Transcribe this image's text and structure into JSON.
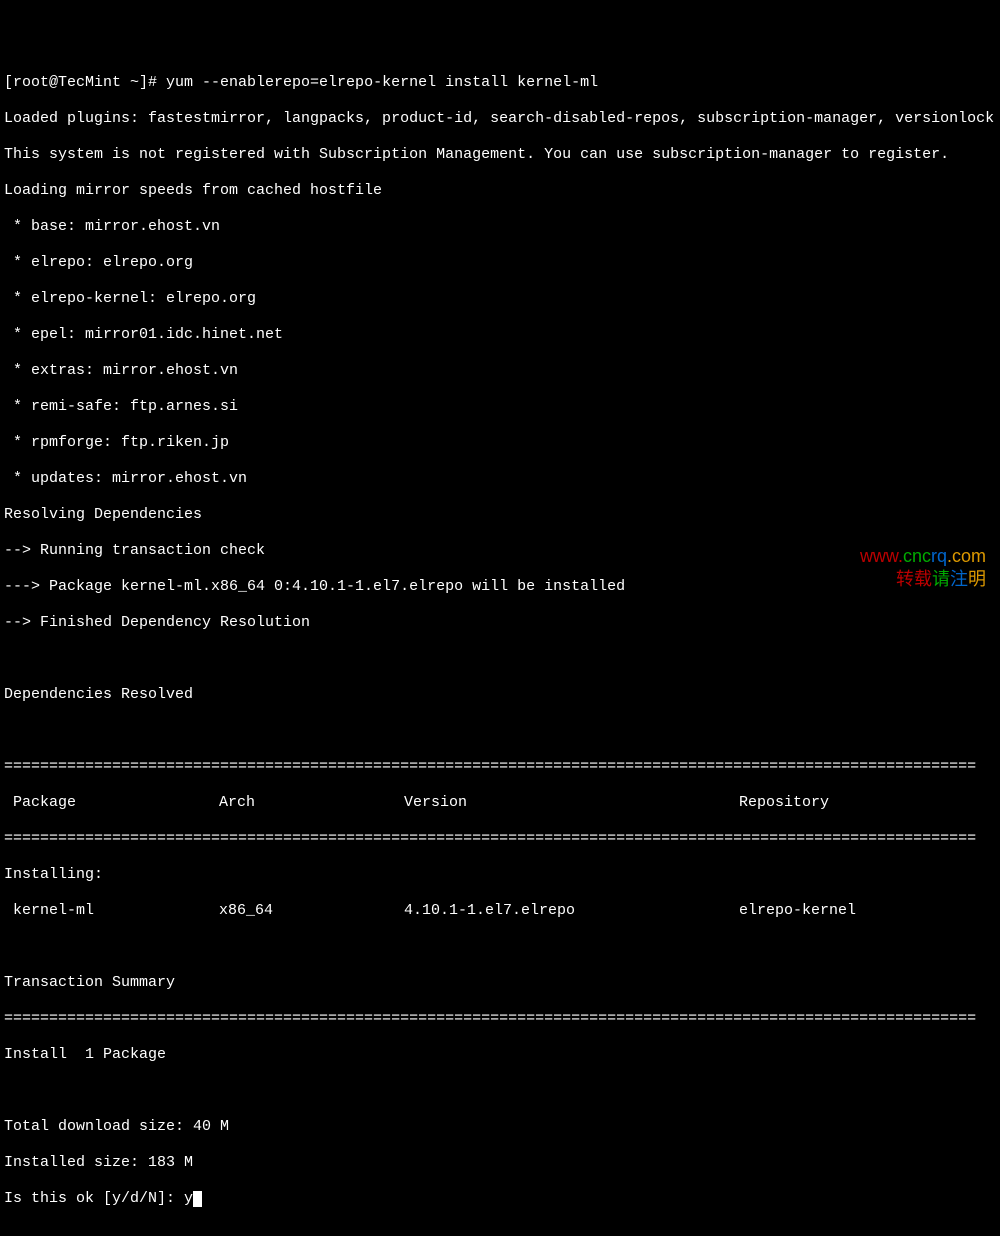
{
  "prompt": {
    "prefix": "[root@TecMint ~]# ",
    "cmd": "yum --enablerepo=elrepo-kernel install kernel-ml"
  },
  "lines": {
    "loaded": "Loaded plugins: fastestmirror, langpacks, product-id, search-disabled-repos, subscription-manager, versionlock",
    "notreg": "This system is not registered with Subscription Management. You can use subscription-manager to register.",
    "mirrors": "Loading mirror speeds from cached hostfile",
    "m_base": " * base: mirror.ehost.vn",
    "m_elrepo": " * elrepo: elrepo.org",
    "m_elk": " * elrepo-kernel: elrepo.org",
    "m_epel": " * epel: mirror01.idc.hinet.net",
    "m_extras": " * extras: mirror.ehost.vn",
    "m_remi": " * remi-safe: ftp.arnes.si",
    "m_rpm": " * rpmforge: ftp.riken.jp",
    "m_upd": " * updates: mirror.ehost.vn",
    "resolv": "Resolving Dependencies",
    "txcheck": "--> Running transaction check",
    "pkgline": "---> Package kernel-ml.x86_64 0:4.10.1-1.el7.elrepo will be installed",
    "finres": "--> Finished Dependency Resolution",
    "depres": "Dependencies Resolved"
  },
  "sep": "============================================================================================================",
  "table": {
    "h_pkg": "Package",
    "h_arch": "Arch",
    "h_ver": "Version",
    "h_repo": "Repository",
    "installing": "Installing:",
    "r_pkg": "kernel-ml",
    "r_arch": "x86_64",
    "r_ver": "4.10.1-1.el7.elrepo",
    "r_repo": "elrepo-kernel",
    "tsummary": "Transaction Summary",
    "install": "Install  1 Package"
  },
  "sizes": {
    "dl": "Total download size: 40 M",
    "inst": "Installed size: 183 M"
  },
  "confirm": {
    "q": "Is this ok [y/d/N]: ",
    "a": "y"
  },
  "watermark": {
    "url_w": "www.",
    "url_c1": "cnc",
    "url_c2": "rq",
    "url_c3": ".com",
    "note_a": "转载",
    "note_b": "请",
    "note_c": "注",
    "note_d": "明"
  }
}
